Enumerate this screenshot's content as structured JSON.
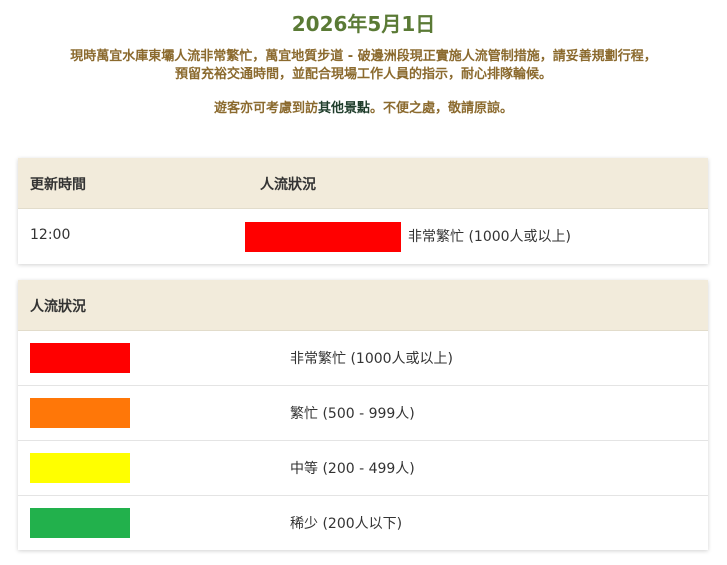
{
  "date_title": "2026年5月1日",
  "notice": {
    "line1": "現時萬宜水庫東壩人流非常繁忙，萬宜地質步道 - 破邊洲段現正實施人流管制措施，請妥善規劃行程，",
    "line2": "預留充裕交通時間，並配合現場工作人員的指示，耐心排隊輪候。",
    "line3_prefix": "遊客亦可考慮到訪",
    "line3_link": "其他景點",
    "line3_suffix": "。不便之處，敬請原諒。"
  },
  "status_table": {
    "headers": [
      "更新時間",
      "人流狀況"
    ],
    "row": {
      "time": "12:00",
      "color": "#ff0000",
      "label": "非常繁忙 (1000人或以上)"
    }
  },
  "legend": {
    "header": "人流狀況",
    "items": [
      {
        "color": "#ff0000",
        "label": "非常繁忙 (1000人或以上)"
      },
      {
        "color": "#ff7708",
        "label": "繁忙 (500 - 999人)"
      },
      {
        "color": "#ffff00",
        "label": "中等 (200 - 499人)"
      },
      {
        "color": "#22b14c",
        "label": "稀少 (200人以下)"
      }
    ]
  }
}
